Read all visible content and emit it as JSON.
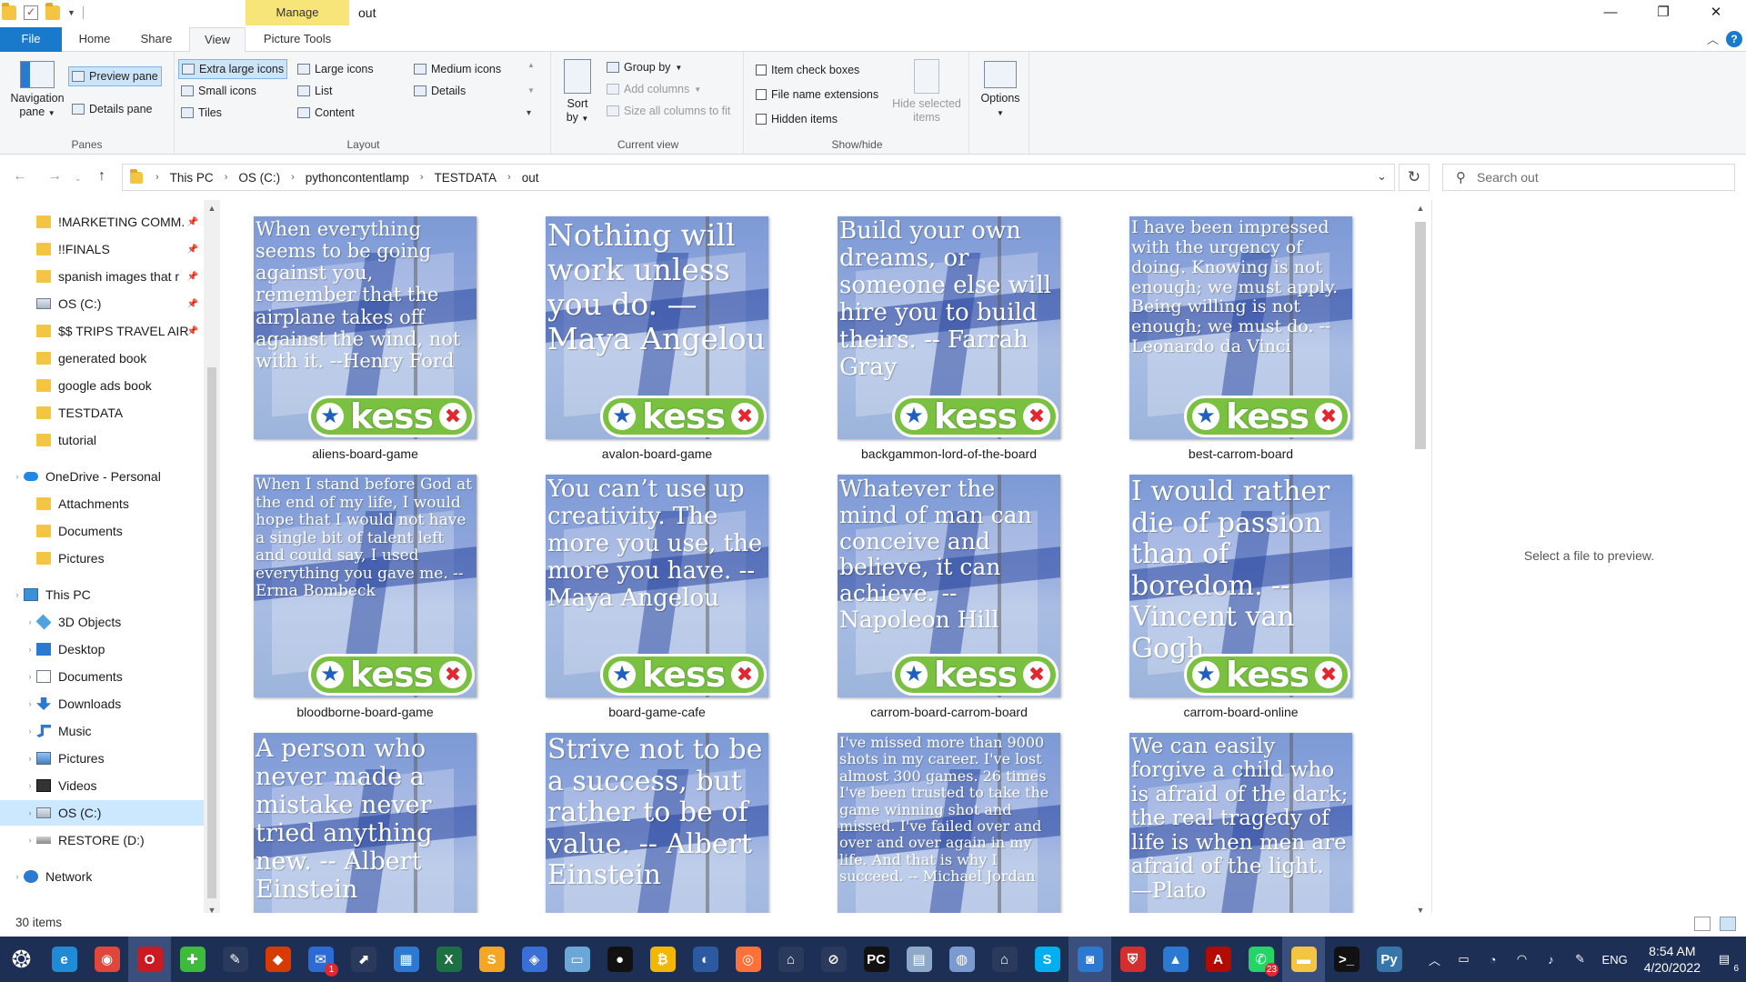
{
  "title_bar": {
    "contextual_tab": "Manage",
    "window_title": "out",
    "minimize": "—",
    "maximize": "❐",
    "close": "✕"
  },
  "tabs": [
    "File",
    "Home",
    "Share",
    "View",
    "Picture Tools"
  ],
  "active_tab": "View",
  "ribbon": {
    "panes": {
      "label": "Panes",
      "navigation_pane": "Navigation\npane",
      "preview_pane": "Preview pane",
      "details_pane": "Details pane"
    },
    "layout": {
      "label": "Layout",
      "extra_large_icons": "Extra large icons",
      "large_icons": "Large icons",
      "medium_icons": "Medium icons",
      "small_icons": "Small icons",
      "list": "List",
      "details": "Details",
      "tiles": "Tiles",
      "content": "Content",
      "selected": "Extra large icons"
    },
    "current_view": {
      "label": "Current view",
      "sort_by": "Sort\nby",
      "group_by": "Group by",
      "add_columns": "Add columns",
      "size_all_columns": "Size all columns to fit"
    },
    "show_hide": {
      "label": "Show/hide",
      "item_check_boxes": "Item check boxes",
      "file_name_extensions": "File name extensions",
      "hidden_items": "Hidden items",
      "hide_selected_items": "Hide selected\nitems"
    },
    "options": "Options"
  },
  "address": {
    "crumbs": [
      "This PC",
      "OS (C:)",
      "pythoncontentlamp",
      "TESTDATA",
      "out"
    ],
    "search_placeholder": "Search out"
  },
  "nav": {
    "quick_access": [
      {
        "label": "!MARKETING COMM.",
        "icon": "folder-icon",
        "pinned": true
      },
      {
        "label": "!!FINALS",
        "icon": "folder-icon",
        "pinned": true
      },
      {
        "label": "spanish images that r",
        "icon": "folder-icon",
        "pinned": true
      },
      {
        "label": "OS (C:)",
        "icon": "drive-icon",
        "pinned": true
      },
      {
        "label": "$$ TRIPS TRAVEL AIR",
        "icon": "folder-icon",
        "pinned": true
      },
      {
        "label": "generated book",
        "icon": "folder-icon",
        "pinned": false
      },
      {
        "label": "google ads book",
        "icon": "folder-icon",
        "pinned": false
      },
      {
        "label": "TESTDATA",
        "icon": "folder-icon",
        "pinned": false
      },
      {
        "label": "tutorial",
        "icon": "folder-icon",
        "pinned": false
      }
    ],
    "onedrive": {
      "label": "OneDrive - Personal",
      "children": [
        "Attachments",
        "Documents",
        "Pictures"
      ]
    },
    "this_pc": {
      "label": "This PC",
      "children": [
        {
          "label": "3D Objects",
          "icon": "cube-icon"
        },
        {
          "label": "Desktop",
          "icon": "desktop-icon"
        },
        {
          "label": "Documents",
          "icon": "documents-icon"
        },
        {
          "label": "Downloads",
          "icon": "downloads-icon"
        },
        {
          "label": "Music",
          "icon": "music-icon"
        },
        {
          "label": "Pictures",
          "icon": "pictures-icon"
        },
        {
          "label": "Videos",
          "icon": "videos-icon"
        },
        {
          "label": "OS (C:)",
          "icon": "drive-icon",
          "selected": true
        },
        {
          "label": "RESTORE (D:)",
          "icon": "restore-drive-icon"
        }
      ]
    },
    "network": "Network"
  },
  "files": [
    {
      "name": "aliens-board-game",
      "quote": "When everything seems to be going against you, remember that the airplane takes off against the wind, not with it. --Henry Ford",
      "font": 21,
      "logo": true
    },
    {
      "name": "avalon-board-game",
      "quote": "Nothing will work unless you do. —Maya Angelou",
      "font": 33,
      "logo": true
    },
    {
      "name": "backgammon-lord-of-the-board",
      "quote": "Build your own dreams, or someone else will hire you to build theirs. -- Farrah Gray",
      "font": 26,
      "logo": true
    },
    {
      "name": "best-carrom-board",
      "quote": "I have been impressed with the urgency of doing. Knowing is not enough; we must apply. Being willing is not enough; we must do. --Leonardo da Vinci",
      "font": 19,
      "logo": true
    },
    {
      "name": "bloodborne-board-game",
      "quote": "When I stand before God at the end of my life, I would hope that I would not have a single bit of talent left and could say, I used everything you gave me. -- Erma Bombeck",
      "font": 17,
      "logo": true
    },
    {
      "name": "board-game-cafe",
      "quote": "You can’t use up creativity. The more you use, the more you have. -- Maya Angelou",
      "font": 26,
      "logo": true
    },
    {
      "name": "carrom-board-carrom-board",
      "quote": "Whatever the mind of man can conceive and believe, it can achieve. -- Napoleon Hill",
      "font": 25,
      "logo": true
    },
    {
      "name": "carrom-board-online",
      "quote": "I would rather die of passion than of boredom. -- Vincent van Gogh",
      "font": 30,
      "logo": true
    },
    {
      "name": "",
      "quote": "A person who never made a mistake never tried anything new. -- Albert Einstein",
      "font": 27,
      "logo": false
    },
    {
      "name": "",
      "quote": "Strive not to be a success, but rather to be of value. -- Albert Einstein",
      "font": 30,
      "logo": false
    },
    {
      "name": "",
      "quote": "I've missed more than 9000 shots in my career. I've lost almost 300 games. 26 times I've been trusted to take the game winning shot and missed. I've failed over and over and over again in my life. And that is why I succeed. -- Michael Jordan",
      "font": 16,
      "logo": false
    },
    {
      "name": "",
      "quote": "We can easily forgive a child who is afraid of the dark; the real tragedy of life is when men are afraid of the light. —Plato",
      "font": 23,
      "logo": false
    }
  ],
  "logo_text": "kess",
  "preview_message": "Select a file to preview.",
  "status": {
    "items": "30 items"
  },
  "taskbar": {
    "apps": [
      {
        "name": "start-icon",
        "color": "#1e2f55",
        "glyph": "❂"
      },
      {
        "name": "edge-icon",
        "color": "#1f8ad6",
        "glyph": "e"
      },
      {
        "name": "chrome-icon",
        "color": "#e0463a",
        "glyph": "◉"
      },
      {
        "name": "opera-icon",
        "color": "#cc1a22",
        "glyph": "O",
        "active": true
      },
      {
        "name": "plus-app-icon",
        "color": "#3dbb3d",
        "glyph": "✚"
      },
      {
        "name": "pen-app-icon",
        "color": "#2a3a5c",
        "glyph": "✎"
      },
      {
        "name": "office-icon",
        "color": "#d83b01",
        "glyph": "◆"
      },
      {
        "name": "mail-app-icon",
        "color": "#2c6bd6",
        "glyph": "✉",
        "badge": "1"
      },
      {
        "name": "vpn-app-icon",
        "color": "#2a3a5c",
        "glyph": "⬈"
      },
      {
        "name": "calendar-icon",
        "color": "#2b79d0",
        "glyph": "▦"
      },
      {
        "name": "excel-icon",
        "color": "#1d7044",
        "glyph": "X"
      },
      {
        "name": "slides-icon",
        "color": "#f5a623",
        "glyph": "S"
      },
      {
        "name": "diamond-app-icon",
        "color": "#3a6fd8",
        "glyph": "◈"
      },
      {
        "name": "notes-app-icon",
        "color": "#6aa6d6",
        "glyph": "▭"
      },
      {
        "name": "record-icon",
        "color": "#111111",
        "glyph": "●"
      },
      {
        "name": "coin-app-icon",
        "color": "#f2b705",
        "glyph": "₿"
      },
      {
        "name": "globe-app-icon",
        "color": "#2c5aa0",
        "glyph": "◐"
      },
      {
        "name": "firefox-icon",
        "color": "#ff7139",
        "glyph": "◎"
      },
      {
        "name": "lock-app-icon",
        "color": "#2a3a5c",
        "glyph": "⌂"
      },
      {
        "name": "dev-app-icon",
        "color": "#2a3a5c",
        "glyph": "⊘"
      },
      {
        "name": "pycharm-icon",
        "color": "#111111",
        "glyph": "PC"
      },
      {
        "name": "scanner-app-icon",
        "color": "#8ea8c8",
        "glyph": "▤"
      },
      {
        "name": "paint-icon",
        "color": "#7a9ad0",
        "glyph": "◍"
      },
      {
        "name": "vpn2-app-icon",
        "color": "#2a3a5c",
        "glyph": "⌂"
      },
      {
        "name": "skype-icon",
        "color": "#00aff0",
        "glyph": "S"
      },
      {
        "name": "screenshot-app-icon",
        "color": "#2b79d0",
        "glyph": "◙",
        "active": true
      },
      {
        "name": "shield-app-icon",
        "color": "#d32f2f",
        "glyph": "⛨"
      },
      {
        "name": "photos-icon",
        "color": "#2b79d0",
        "glyph": "▲"
      },
      {
        "name": "acrobat-icon",
        "color": "#b30b00",
        "glyph": "A"
      },
      {
        "name": "whatsapp-icon",
        "color": "#25d366",
        "glyph": "✆",
        "badge": "23"
      },
      {
        "name": "file-explorer-icon",
        "color": "#f4c542",
        "glyph": "▬",
        "active": true
      },
      {
        "name": "terminal-icon",
        "color": "#111111",
        "glyph": ">_"
      },
      {
        "name": "python-icon",
        "color": "#3776ab",
        "glyph": "Py"
      }
    ],
    "language": "ENG",
    "time": "8:54 AM",
    "date": "4/20/2022",
    "notifications": "6"
  }
}
